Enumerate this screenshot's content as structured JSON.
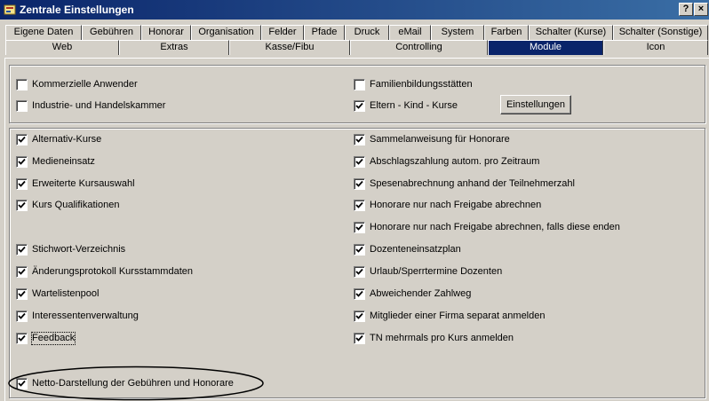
{
  "window": {
    "title": "Zentrale Einstellungen",
    "help_label": "?",
    "close_label": "×"
  },
  "tabs_row1": [
    {
      "label": "Eigene Daten"
    },
    {
      "label": "Gebühren"
    },
    {
      "label": "Honorar"
    },
    {
      "label": "Organisation"
    },
    {
      "label": "Felder"
    },
    {
      "label": "Pfade"
    },
    {
      "label": "Druck"
    },
    {
      "label": "eMail"
    },
    {
      "label": "System"
    },
    {
      "label": "Farben"
    },
    {
      "label": "Schalter (Kurse)"
    },
    {
      "label": "Schalter (Sonstige)"
    }
  ],
  "tabs_row2": [
    {
      "label": "Web"
    },
    {
      "label": "Extras"
    },
    {
      "label": "Kasse/Fibu"
    },
    {
      "label": "Controlling"
    },
    {
      "label": "Module",
      "active": true
    },
    {
      "label": "Icon"
    }
  ],
  "group1": [
    {
      "label": "Kommerzielle Anwender",
      "checked": false
    },
    {
      "label": "Industrie- und Handelskammer",
      "checked": false
    },
    {
      "label": "Familienbildungsstätten",
      "checked": false
    },
    {
      "label": "Eltern - Kind - Kurse",
      "checked": true
    }
  ],
  "settings_button": "Einstellungen",
  "group2_left": [
    {
      "label": "Alternativ-Kurse",
      "checked": true
    },
    {
      "label": "Medieneinsatz",
      "checked": true
    },
    {
      "label": "Erweiterte Kursauswahl",
      "checked": true
    },
    {
      "label": "Kurs Qualifikationen",
      "checked": true
    },
    {
      "label": "Stichwort-Verzeichnis",
      "checked": true
    },
    {
      "label": "Änderungsprotokoll Kursstammdaten",
      "checked": true
    },
    {
      "label": "Wartelistenpool",
      "checked": true
    },
    {
      "label": "Interessentenverwaltung",
      "checked": true
    },
    {
      "label": "Feedback",
      "checked": true,
      "focused": true
    },
    {
      "label": "Netto-Darstellung der Gebühren und Honorare",
      "checked": true
    }
  ],
  "group2_right": [
    {
      "label": "Sammelanweisung für Honorare",
      "checked": true
    },
    {
      "label": "Abschlagszahlung autom. pro Zeitraum",
      "checked": true
    },
    {
      "label": "Spesenabrechnung anhand der Teilnehmerzahl",
      "checked": true
    },
    {
      "label": "Honorare nur nach Freigabe abrechnen",
      "checked": true
    },
    {
      "label": "Honorare nur nach Freigabe abrechnen, falls diese enden",
      "checked": true
    },
    {
      "label": "Dozenteneinsatzplan",
      "checked": true
    },
    {
      "label": "Urlaub/Sperrtermine Dozenten",
      "checked": true
    },
    {
      "label": "Abweichender Zahlweg",
      "checked": true
    },
    {
      "label": "Mitglieder einer Firma separat anmelden",
      "checked": true
    },
    {
      "label": "TN mehrmals pro Kurs anmelden",
      "checked": true
    }
  ],
  "colors": {
    "titlebar": "#0a246a",
    "face": "#d4d0c8",
    "active_tab": "#0a246a"
  }
}
